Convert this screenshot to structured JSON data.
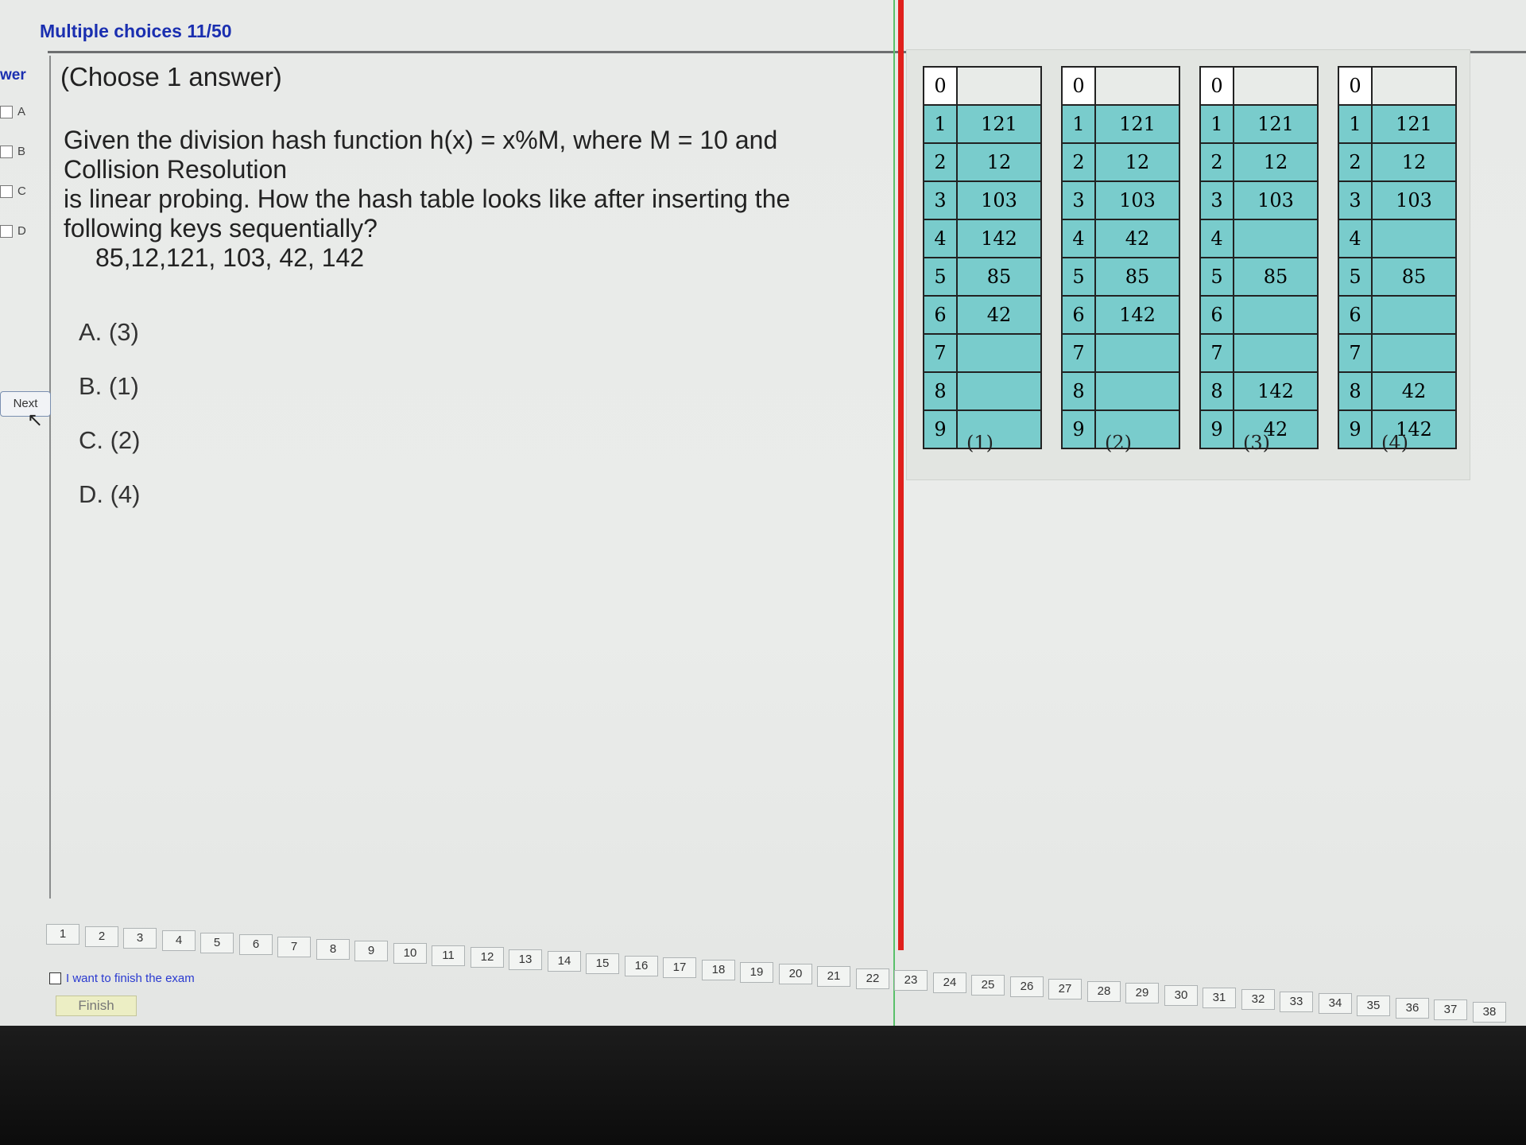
{
  "header": {
    "title": "Multiple choices 11/50"
  },
  "answer_sidebar": {
    "heading": "wer",
    "options": [
      "A",
      "B",
      "C",
      "D"
    ],
    "next_label": "Next"
  },
  "question": {
    "instruction": "(Choose 1 answer)",
    "lines": [
      "Given the division hash function h(x) = x%M, where M = 10 and",
      "Collision Resolution",
      "is linear probing. How the hash table looks like after inserting the",
      "following keys sequentially?"
    ],
    "keys": "85,12,121, 103, 42, 142",
    "choices": [
      "A. (3)",
      "B. (1)",
      "C. (2)",
      "D. (4)"
    ]
  },
  "figure": {
    "tables": [
      {
        "caption": "(1)",
        "rows": [
          [
            "0",
            ""
          ],
          [
            "1",
            "121"
          ],
          [
            "2",
            "12"
          ],
          [
            "3",
            "103"
          ],
          [
            "4",
            "142"
          ],
          [
            "5",
            "85"
          ],
          [
            "6",
            "42"
          ],
          [
            "7",
            ""
          ],
          [
            "8",
            ""
          ],
          [
            "9",
            ""
          ]
        ]
      },
      {
        "caption": "(2)",
        "rows": [
          [
            "0",
            ""
          ],
          [
            "1",
            "121"
          ],
          [
            "2",
            "12"
          ],
          [
            "3",
            "103"
          ],
          [
            "4",
            "42"
          ],
          [
            "5",
            "85"
          ],
          [
            "6",
            "142"
          ],
          [
            "7",
            ""
          ],
          [
            "8",
            ""
          ],
          [
            "9",
            ""
          ]
        ]
      },
      {
        "caption": "(3)",
        "rows": [
          [
            "0",
            ""
          ],
          [
            "1",
            "121"
          ],
          [
            "2",
            "12"
          ],
          [
            "3",
            "103"
          ],
          [
            "4",
            ""
          ],
          [
            "5",
            "85"
          ],
          [
            "6",
            ""
          ],
          [
            "7",
            ""
          ],
          [
            "8",
            "142"
          ],
          [
            "9",
            "42"
          ]
        ]
      },
      {
        "caption": "(4)",
        "rows": [
          [
            "0",
            ""
          ],
          [
            "1",
            "121"
          ],
          [
            "2",
            "12"
          ],
          [
            "3",
            "103"
          ],
          [
            "4",
            ""
          ],
          [
            "5",
            "85"
          ],
          [
            "6",
            ""
          ],
          [
            "7",
            ""
          ],
          [
            "8",
            "42"
          ],
          [
            "9",
            "142"
          ]
        ]
      }
    ]
  },
  "pager": {
    "pages": [
      "1",
      "2",
      "3",
      "4",
      "5",
      "6",
      "7",
      "8",
      "9",
      "10",
      "11",
      "12",
      "13",
      "14",
      "15",
      "16",
      "17",
      "18",
      "19",
      "20",
      "21",
      "22",
      "23",
      "24",
      "25",
      "26",
      "27",
      "28",
      "29",
      "30",
      "31",
      "32",
      "33",
      "34",
      "35",
      "36",
      "37",
      "38"
    ],
    "finish_checkbox_label": "I want to finish the exam",
    "finish_label": "Finish"
  },
  "colors": {
    "title_blue": "#1a2fb0",
    "table_fill": "#79cccc",
    "divider_red": "#e0201c"
  }
}
